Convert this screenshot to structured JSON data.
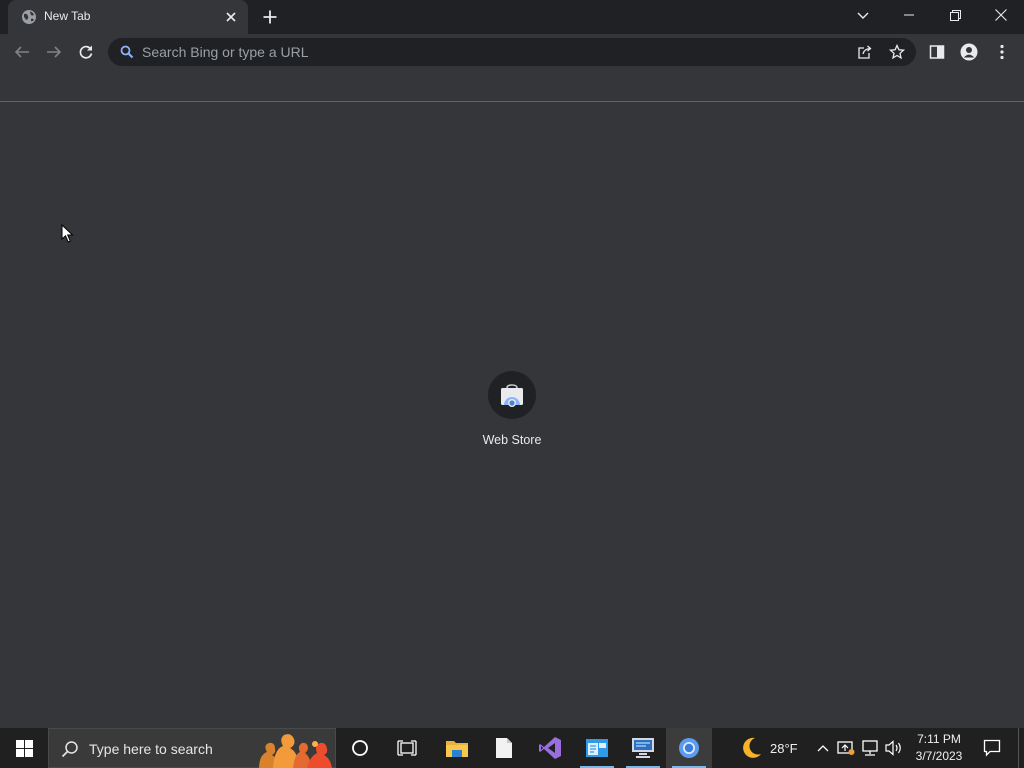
{
  "tab": {
    "title": "New Tab",
    "favicon": "globe-icon"
  },
  "omnibox": {
    "placeholder": "Search Bing or type a URL",
    "value": ""
  },
  "shortcuts": [
    {
      "title": "Web Store",
      "icon": "web-store-icon"
    }
  ],
  "taskbar": {
    "search_placeholder": "Type here to search",
    "apps": [
      "cortana",
      "task-view",
      "file-explorer",
      "notepad",
      "visual-studio",
      "app-window",
      "remote-desktop",
      "chrome"
    ],
    "active_app": "chrome",
    "weather": {
      "temperature": "28°F",
      "icon": "moon-icon"
    },
    "clock": {
      "time": "7:11 PM",
      "date": "3/7/2023"
    }
  },
  "colors": {
    "page_background": "#35363a",
    "tabstrip_background": "#202124",
    "taskbar_background": "#202020",
    "accent": "#8ab4f8"
  }
}
